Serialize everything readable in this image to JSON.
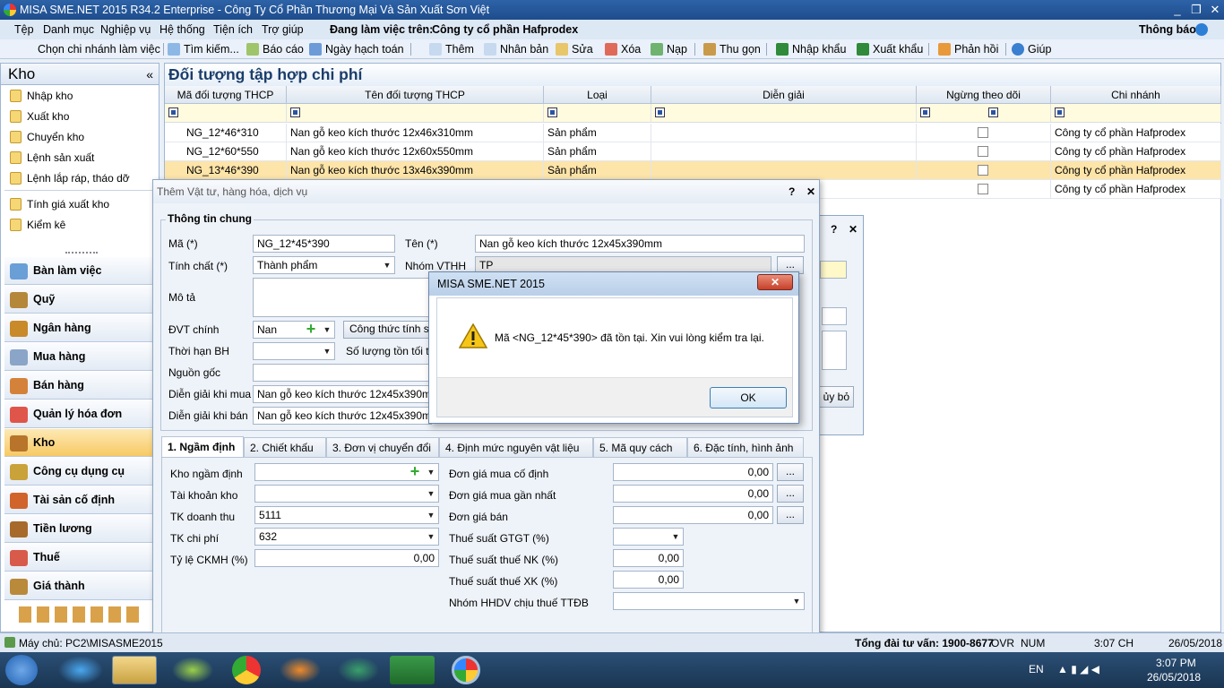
{
  "app": {
    "title": "MISA SME.NET 2015 R34.2 Enterprise - Công Ty Cổ Phần Thương Mại Và Sản Xuất Sơn Việt",
    "win_min": "_",
    "win_max": "❐",
    "win_close": "✕"
  },
  "menu": {
    "items": [
      "Tệp",
      "Danh mục",
      "Nghiệp vụ",
      "Hệ thống",
      "Tiện ích",
      "Trợ giúp"
    ],
    "working_label": "Đang làm việc trên:",
    "company": "Công ty cổ phần Hafprodex",
    "notify": "Thông báo"
  },
  "toolbar": {
    "items": [
      "Chọn chi nhánh làm việc",
      "Tìm kiếm...",
      "Báo cáo",
      "Ngày hạch toán",
      "Thêm",
      "Nhân bản",
      "Sửa",
      "Xóa",
      "Nạp",
      "Thu gọn",
      "Nhập khẩu",
      "Xuất khẩu",
      "Phản hồi",
      "Giúp"
    ]
  },
  "sidebar": {
    "title": "Kho",
    "collapse": "«",
    "items": [
      "Nhập kho",
      "Xuất kho",
      "Chuyển kho",
      "Lệnh sản xuất",
      "Lệnh lắp ráp, tháo dỡ",
      "Tính giá xuất kho",
      "Kiểm kê"
    ],
    "modules": [
      "Bàn làm việc",
      "Quỹ",
      "Ngân hàng",
      "Mua hàng",
      "Bán hàng",
      "Quản lý hóa đơn",
      "Kho",
      "Công cụ dụng cụ",
      "Tài sản cố định",
      "Tiền lương",
      "Thuế",
      "Giá thành"
    ]
  },
  "main": {
    "title": "Đối tượng tập hợp chi phí",
    "columns": [
      "Mã đối tượng THCP",
      "Tên đối tượng THCP",
      "Loại",
      "Diễn giải",
      "Ngừng theo dõi",
      "Chi nhánh"
    ],
    "rows": [
      {
        "code": "NG_12*46*310",
        "name": "Nan gỗ keo kích thước 12x46x310mm",
        "type": "Sản phẩm",
        "branch": "Công ty cổ phần Hafprodex"
      },
      {
        "code": "NG_12*60*550",
        "name": "Nan gỗ keo kích thước 12x60x550mm",
        "type": "Sản phẩm",
        "branch": "Công ty cổ phần Hafprodex"
      },
      {
        "code": "NG_13*46*390",
        "name": "Nan gỗ keo kích thước 13x46x390mm",
        "type": "Sản phẩm",
        "branch": "Công ty cổ phần Hafprodex"
      },
      {
        "code": "",
        "name": "",
        "type": "",
        "branch": "Công ty cổ phần Hafprodex"
      }
    ]
  },
  "dialog": {
    "title": "Thêm Vật tư, hàng hóa, dịch vụ",
    "help": "?",
    "close": "✕",
    "section": "Thông tin chung",
    "labels": {
      "code": "Mã (*)",
      "name": "Tên (*)",
      "nature": "Tính chất (*)",
      "group": "Nhóm VTHH",
      "desc": "Mô tả",
      "unit": "ĐVT chính",
      "formula": "Công thức tính số",
      "warranty": "Thời hạn BH",
      "min_stock": "Số lượng tồn tối thiểu",
      "origin": "Nguồn gốc",
      "buy_desc": "Diễn giải khi mua",
      "sell_desc": "Diễn giải khi bán"
    },
    "values": {
      "code": "NG_12*45*390",
      "name": "Nan gỗ keo kích thước 12x45x390mm",
      "nature": "Thành phẩm",
      "group": "TP",
      "unit": "Nan",
      "buy_desc": "Nan gỗ keo kích thước 12x45x390mm",
      "sell_desc": "Nan gỗ keo kích thước 12x45x390mm"
    },
    "tabs": [
      "1. Ngầm định",
      "2. Chiết khấu",
      "3. Đơn vị chuyển đổi",
      "4. Định mức nguyên vật liệu",
      "5. Mã quy cách",
      "6. Đặc tính, hình ảnh"
    ],
    "tab1": {
      "labels": {
        "default_wh": "Kho ngầm định",
        "wh_account": "Tài khoản kho",
        "revenue": "TK doanh thu",
        "expense": "TK chi phí",
        "discount": "Tỷ lệ CKMH (%)",
        "fixed_price": "Đơn giá mua cố định",
        "last_price": "Đơn giá mua gần nhất",
        "sell_price": "Đơn giá bán",
        "vat": "Thuế suất GTGT (%)",
        "import_tax": "Thuế suất thuế NK (%)",
        "export_tax": "Thuế suất thuế XK (%)",
        "special_tax": "Nhóm HHDV chịu thuế TTĐB"
      },
      "values": {
        "revenue": "5111",
        "expense": "632",
        "discount": "0,00",
        "fixed_price": "0,00",
        "last_price": "0,00",
        "sell_price": "0,00",
        "import_tax": "0,00",
        "export_tax": "0,00"
      }
    },
    "ellipsis": "...",
    "cancel_partial": "ủy bỏ",
    "help2": "?",
    "close2": "✕"
  },
  "message": {
    "title": "MISA SME.NET 2015",
    "close": "✕",
    "text": "Mã <NG_12*45*390> đã tồn tại. Xin vui lòng kiểm tra lại.",
    "ok": "OK"
  },
  "status": {
    "server": "Máy chủ: PC2\\MISASME2015",
    "hotline": "Tổng đài tư vấn: 1900-8677",
    "ovr": "OVR",
    "num": "NUM",
    "time": "3:07 CH",
    "date": "26/05/2018"
  },
  "taskbar": {
    "lang": "EN",
    "time": "3:07 PM",
    "date": "26/05/2018"
  },
  "colors": {
    "accent": "#1e4c8c",
    "selected_row": "#fde4a9",
    "active_module": "#f7c964"
  }
}
